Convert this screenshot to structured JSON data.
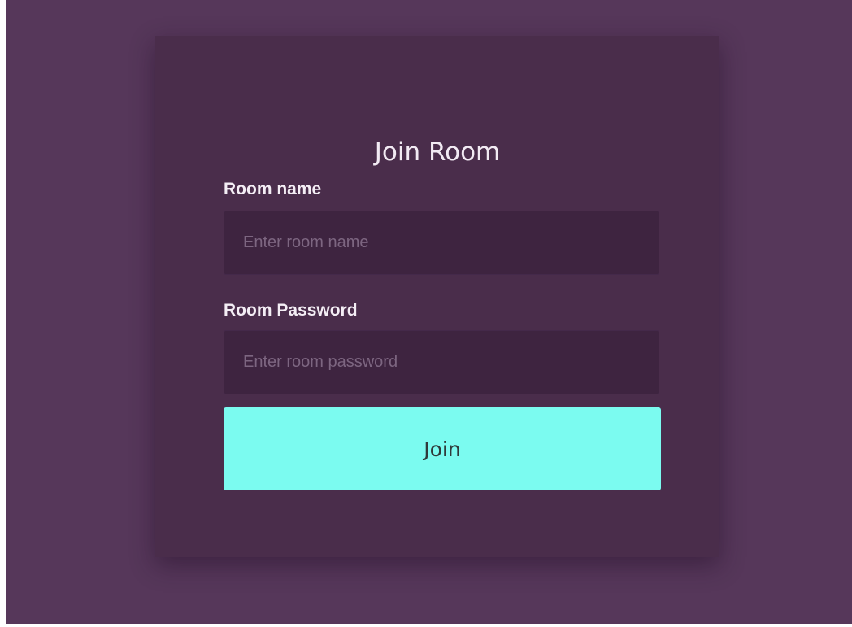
{
  "form": {
    "title": "Join Room",
    "room_name": {
      "label": "Room name",
      "placeholder": "Enter room name",
      "value": ""
    },
    "room_password": {
      "label": "Room Password",
      "placeholder": "Enter room password",
      "value": ""
    },
    "submit_label": "Join"
  },
  "colors": {
    "page_background": "#56375a",
    "card_background": "#4a2d4b",
    "input_background": "#3e2440",
    "button_accent": "#7bfbf0"
  }
}
